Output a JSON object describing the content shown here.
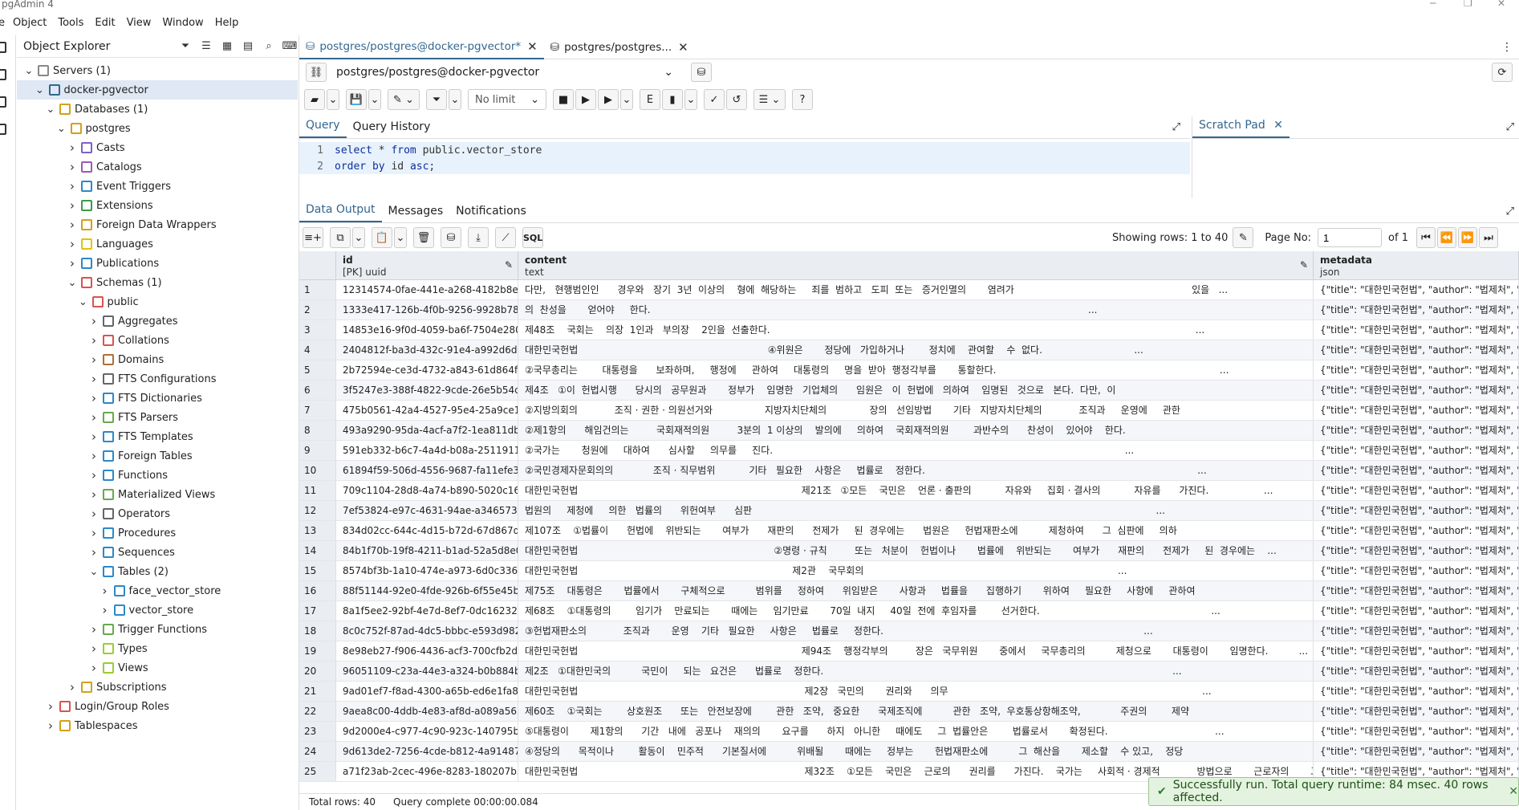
{
  "window": {
    "title": "pgAdmin 4"
  },
  "menu": [
    "e",
    "Object",
    "Tools",
    "Edit",
    "View",
    "Window",
    "Help"
  ],
  "explorer": {
    "title": "Object Explorer",
    "tree": [
      {
        "label": "Servers (1)",
        "depth": 0,
        "chev": "down",
        "icon": "servers-icon",
        "color": "#888"
      },
      {
        "label": "docker-pgvector",
        "depth": 1,
        "chev": "down",
        "icon": "server-icon",
        "color": "#336791",
        "selected": true
      },
      {
        "label": "Databases (1)",
        "depth": 2,
        "chev": "down",
        "icon": "databases-icon",
        "color": "#d4a017"
      },
      {
        "label": "postgres",
        "depth": 3,
        "chev": "down",
        "icon": "database-icon",
        "color": "#d4a017"
      },
      {
        "label": "Casts",
        "depth": 4,
        "chev": "right",
        "icon": "casts-icon",
        "color": "#7b61c9"
      },
      {
        "label": "Catalogs",
        "depth": 4,
        "chev": "right",
        "icon": "catalogs-icon",
        "color": "#9b59b6"
      },
      {
        "label": "Event Triggers",
        "depth": 4,
        "chev": "right",
        "icon": "event-triggers-icon",
        "color": "#2d88c8"
      },
      {
        "label": "Extensions",
        "depth": 4,
        "chev": "right",
        "icon": "extensions-icon",
        "color": "#3a9a4a"
      },
      {
        "label": "Foreign Data Wrappers",
        "depth": 4,
        "chev": "right",
        "icon": "fdw-icon",
        "color": "#d4a017"
      },
      {
        "label": "Languages",
        "depth": 4,
        "chev": "right",
        "icon": "languages-icon",
        "color": "#e2c400"
      },
      {
        "label": "Publications",
        "depth": 4,
        "chev": "right",
        "icon": "publications-icon",
        "color": "#2d88c8"
      },
      {
        "label": "Schemas (1)",
        "depth": 4,
        "chev": "down",
        "icon": "schemas-icon",
        "color": "#d9534f"
      },
      {
        "label": "public",
        "depth": 5,
        "chev": "down",
        "icon": "schema-icon",
        "color": "#d9534f"
      },
      {
        "label": "Aggregates",
        "depth": 6,
        "chev": "right",
        "icon": "aggregates-icon",
        "color": "#666"
      },
      {
        "label": "Collations",
        "depth": 6,
        "chev": "right",
        "icon": "collations-icon",
        "color": "#d9534f"
      },
      {
        "label": "Domains",
        "depth": 6,
        "chev": "right",
        "icon": "domains-icon",
        "color": "#b06f36"
      },
      {
        "label": "FTS Configurations",
        "depth": 6,
        "chev": "right",
        "icon": "fts-config-icon",
        "color": "#666"
      },
      {
        "label": "FTS Dictionaries",
        "depth": 6,
        "chev": "right",
        "icon": "fts-dict-icon",
        "color": "#2d88c8"
      },
      {
        "label": "FTS Parsers",
        "depth": 6,
        "chev": "right",
        "icon": "fts-parsers-icon",
        "color": "#6aa84f"
      },
      {
        "label": "FTS Templates",
        "depth": 6,
        "chev": "right",
        "icon": "fts-templates-icon",
        "color": "#2d88c8"
      },
      {
        "label": "Foreign Tables",
        "depth": 6,
        "chev": "right",
        "icon": "foreign-tables-icon",
        "color": "#2d88c8"
      },
      {
        "label": "Functions",
        "depth": 6,
        "chev": "right",
        "icon": "functions-icon",
        "color": "#2d88c8"
      },
      {
        "label": "Materialized Views",
        "depth": 6,
        "chev": "right",
        "icon": "materialized-views-icon",
        "color": "#6aa84f"
      },
      {
        "label": "Operators",
        "depth": 6,
        "chev": "right",
        "icon": "operators-icon",
        "color": "#666"
      },
      {
        "label": "Procedures",
        "depth": 6,
        "chev": "right",
        "icon": "procedures-icon",
        "color": "#2d88c8"
      },
      {
        "label": "Sequences",
        "depth": 6,
        "chev": "right",
        "icon": "sequences-icon",
        "color": "#2d88c8"
      },
      {
        "label": "Tables (2)",
        "depth": 6,
        "chev": "down",
        "icon": "tables-icon",
        "color": "#2d88c8"
      },
      {
        "label": "face_vector_store",
        "depth": 7,
        "chev": "right",
        "icon": "table-icon",
        "color": "#2d88c8"
      },
      {
        "label": "vector_store",
        "depth": 7,
        "chev": "right",
        "icon": "table-icon",
        "color": "#2d88c8"
      },
      {
        "label": "Trigger Functions",
        "depth": 6,
        "chev": "right",
        "icon": "trigger-functions-icon",
        "color": "#6aa84f"
      },
      {
        "label": "Types",
        "depth": 6,
        "chev": "right",
        "icon": "types-icon",
        "color": "#9acd32"
      },
      {
        "label": "Views",
        "depth": 6,
        "chev": "right",
        "icon": "views-icon",
        "color": "#9acd32"
      },
      {
        "label": "Subscriptions",
        "depth": 4,
        "chev": "right",
        "icon": "subscriptions-icon",
        "color": "#d4a017"
      },
      {
        "label": "Login/Group Roles",
        "depth": 2,
        "chev": "right",
        "icon": "roles-icon",
        "color": "#d9534f"
      },
      {
        "label": "Tablespaces",
        "depth": 2,
        "chev": "right",
        "icon": "tablespaces-icon",
        "color": "#d4a017"
      }
    ]
  },
  "tabs": [
    {
      "label": "postgres/postgres@docker-pgvector*",
      "active": true
    },
    {
      "label": "postgres/postgres...",
      "active": false
    }
  ],
  "connection": {
    "value": "postgres/postgres@docker-pgvector"
  },
  "toolbar": {
    "limit": "No limit"
  },
  "query_tabs": [
    "Query",
    "Query History"
  ],
  "editor": {
    "lines": [
      [
        {
          "t": "select",
          "k": true
        },
        {
          "t": " * ",
          "k": false
        },
        {
          "t": "from",
          "k": true
        },
        {
          "t": " public.vector_store",
          "k": false
        }
      ],
      [
        {
          "t": "order by",
          "k": true
        },
        {
          "t": " id ",
          "k": false
        },
        {
          "t": "asc",
          "k": true
        },
        {
          "t": ";",
          "k": false
        }
      ]
    ]
  },
  "scratch": {
    "label": "Scratch Pad"
  },
  "output_tabs": [
    "Data Output",
    "Messages",
    "Notifications"
  ],
  "pager": {
    "showing": "Showing rows: 1 to 40",
    "page_label": "Page No:",
    "page_value": "1",
    "of": "of 1"
  },
  "grid": {
    "columns": [
      {
        "name": "id",
        "type": "[PK] uuid"
      },
      {
        "name": "content",
        "type": "text"
      },
      {
        "name": "metadata",
        "type": "json"
      }
    ],
    "metadata_value": "{\"title\": \"대한민국헌법\", \"author\": \"법제처\", \"sou",
    "rows": [
      {
        "n": "1",
        "id": "12314574-0fae-441e-a268-4182b8e8...",
        "content": "다만,   현행범인인      경우와   장기  3년  이상의    형에  해당하는     죄를  범하고   도피  또는   증거인멸의       염려가                                                          있을   ..."
      },
      {
        "n": "2",
        "id": "1333e417-126b-4f0b-9256-9928b78a...",
        "content": "의  찬성을       얻어야     한다.                                                                                                                                               ..."
      },
      {
        "n": "3",
        "id": "14853e16-9f0d-4059-ba6f-7504e280...",
        "content": "제48조    국회는    의장  1인과   부의장    2인을  선출한다.                                                                                                                                           ..."
      },
      {
        "n": "4",
        "id": "2404812f-ba3d-432c-91e4-a992d6d4...",
        "content": "대한민국헌법                                                              ④위원은       정당에   가입하거나        정치에    관여할    수  없다.                              ..."
      },
      {
        "n": "5",
        "id": "2b72594e-ce3d-4732-a843-61d864f6...",
        "content": "②국무총리는        대통령을      보좌하며,     행정에     관하여     대통령의     명을  받아  행정각부를       통할한다.                                                                         ..."
      },
      {
        "n": "6",
        "id": "3f5247e3-388f-4822-9cde-26e5b54c...",
        "content": "제4조   ①이  헌법시행      당시의   공무원과       정부가    임명한   기업체의      임원은   이  헌법에   의하여    임명된   것으로   본다.  다만,  이"
      },
      {
        "n": "7",
        "id": "475b0561-42a4-4527-95e4-25a9ce1...",
        "content": "②지방의회의            조직 · 권한 · 의원선거와                 지방자치단체의              장의   선임방법       기타   지방자치단체의            조직과     운영에     관한"
      },
      {
        "n": "8",
        "id": "493a9290-95da-4acf-a7f2-1ea811db...",
        "content": "②제1항의      해임건의는         국회재적의원         3분의  1 이상의    발의에     의하여    국회재적의원        과반수의      찬성이    있어야    한다."
      },
      {
        "n": "9",
        "id": "591eb332-b6c7-4a4d-b08a-2511911...",
        "content": "②국가는       청원에     대하여      심사할     의무를     진다.                                                                                                                   ..."
      },
      {
        "n": "10",
        "id": "61894f59-506d-4556-9687-fa11efe3...",
        "content": "②국민경제자문회의의             조직 · 직무범위           기타   필요한    사항은     법률로    정한다.                                                                                         ..."
      },
      {
        "n": "11",
        "id": "709c1104-28d8-4a74-b890-5020c16...",
        "content": "대한민국헌법                                                                         제21조   ①모든    국민은    언론 · 출판의           자유와     집회 · 결사의           자유를      가진다.                  ..."
      },
      {
        "n": "12",
        "id": "7ef53824-e97c-4631-94ae-a3465734...",
        "content": "법원의     제청에     의한   법률의      위헌여부      심판                                                                                                                                    ..."
      },
      {
        "n": "13",
        "id": "834d02cc-644c-4d15-b72d-67d867d...",
        "content": "제107조    ①법률이      헌법에    위반되는       여부가      재판의      전제가     된  경우에는      법원은     헌법재판소에          제청하여      그  심판에     의하"
      },
      {
        "n": "14",
        "id": "84b1f70b-19f8-4211-b1ad-52a5d8e0...",
        "content": "대한민국헌법                                                                ②명령 · 규칙         또는   처분이    헌법이나       법률에    위반되는       여부가      재판의      전제가     된  경우에는    ..."
      },
      {
        "n": "15",
        "id": "8574bf3b-1a10-474e-a973-6d0c336b...",
        "content": "대한민국헌법                                                                      제2관    국무회의                                                                                   ..."
      },
      {
        "n": "16",
        "id": "88f51144-92e0-4fde-926b-6f55e45b...",
        "content": "제75조    대통령은       법률에서       구체적으로          범위를     정하여      위임받은       사항과     법률을      집행하기       위하여     필요한     사항에     관하여"
      },
      {
        "n": "17",
        "id": "8a1f5ee2-92bf-4e7d-8ef7-0dc16232b...",
        "content": "제68조    ①대통령의        임기가    만료되는       때에는     임기만료       70일  내지     40일  전에  후임자를        선거한다.                                                        ..."
      },
      {
        "n": "18",
        "id": "8c0c752f-87ad-4dc5-bbbc-e593d982...",
        "content": "③헌법재판소의            조직과       운영    기타   필요한     사항은     법률로     정한다.                                                                                     ..."
      },
      {
        "n": "19",
        "id": "8e98eb27-f906-4436-acf3-700cfb2d3...",
        "content": "대한민국헌법                                                                         제94조    행정각부의         장은   국무위원       중에서     국무총리의          제청으로       대통령이       임명한다.          ..."
      },
      {
        "n": "20",
        "id": "96051109-c23a-44e3-a324-b0b884b...",
        "content": "제2조   ①대한민국의          국민이     되는   요건은      법률로    정한다.                                                                                                                  ..."
      },
      {
        "n": "21",
        "id": "9ad01ef7-f8ad-4300-a65b-ed6e1fa8c...",
        "content": "대한민국헌법                                                                          제2장   국민의       권리와      의무                                                                                   ..."
      },
      {
        "n": "22",
        "id": "9aea8c00-4ddb-4e83-af8d-a089a563...",
        "content": "제60조    ①국회는        상호원조      또는   안전보장에        관한   조약,   중요한      국제조직에          관한   조약,  우호통상항해조약,             주권의        제약"
      },
      {
        "n": "23",
        "id": "9d2000e4-c977-4c90-923c-140795b...",
        "content": "⑤대통령이       제1항의      기간   내에   공포나    재의의       요구를      하지   아니한     때에도     그  법률안은        법률로서       확정된다.                                   ..."
      },
      {
        "n": "24",
        "id": "9d613de2-7256-4cde-b812-4a91487...",
        "content": "④정당의      목적이나        활동이    민주적      기본질서에          위배될       때에는     정부는       헌법재판소에          그  해산을       제소할    수 있고,    정당"
      },
      {
        "n": "25",
        "id": "a71f23ab-2cec-496e-8283-180207b5...",
        "content": "대한민국헌법                                                                          제32조    ①모든    국민은    근로의      권리를      가진다.    국가는     사회적 · 경제적            방법으로       근로자의       고용"
      }
    ]
  },
  "status": {
    "total": "Total rows: 40",
    "complete": "Query complete 00:00:00.084"
  },
  "toast": {
    "text": "Successfully run. Total query runtime: 84 msec. 40 rows affected."
  }
}
